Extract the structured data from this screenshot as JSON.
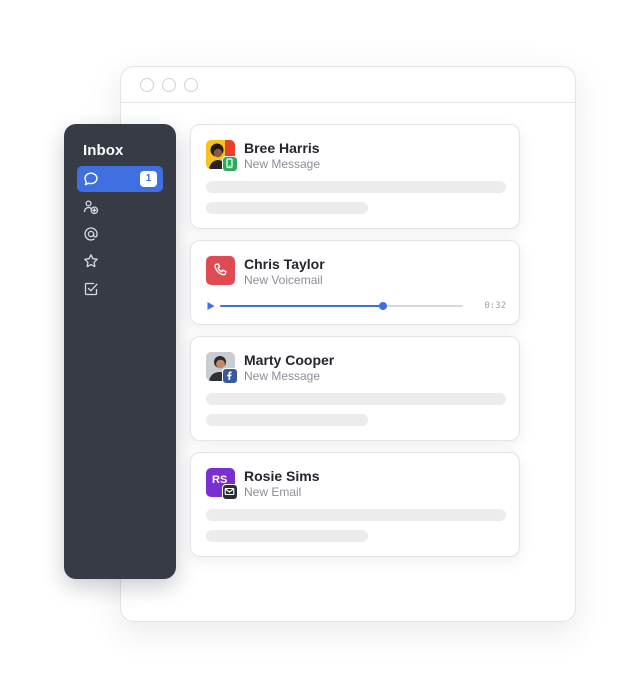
{
  "colors": {
    "sidebar_bg": "#373b45",
    "accent": "#3f6fe0",
    "voicemail_red": "#e04a52",
    "message_green": "#2fab60",
    "facebook_blue": "#3b5998",
    "email_purple": "#7a2fd1"
  },
  "sidebar": {
    "title": "Inbox",
    "items": [
      {
        "icon": "chat-bubble-icon",
        "active": true,
        "badge": "1"
      },
      {
        "icon": "contacts-add-icon",
        "active": false
      },
      {
        "icon": "at-mention-icon",
        "active": false
      },
      {
        "icon": "star-icon",
        "active": false
      },
      {
        "icon": "checkbox-done-icon",
        "active": false
      }
    ]
  },
  "conversations": [
    {
      "name": "Bree Harris",
      "subtitle": "New Message",
      "channel": "sms-message-icon"
    },
    {
      "name": "Chris Taylor",
      "subtitle": "New Voicemail",
      "channel": "phone-icon",
      "duration": "0:32",
      "progress": 0.67
    },
    {
      "name": "Marty Cooper",
      "subtitle": "New Message",
      "channel": "facebook-icon"
    },
    {
      "name": "Rosie Sims",
      "subtitle": "New Email",
      "channel": "email-icon",
      "initials": "RS"
    }
  ]
}
